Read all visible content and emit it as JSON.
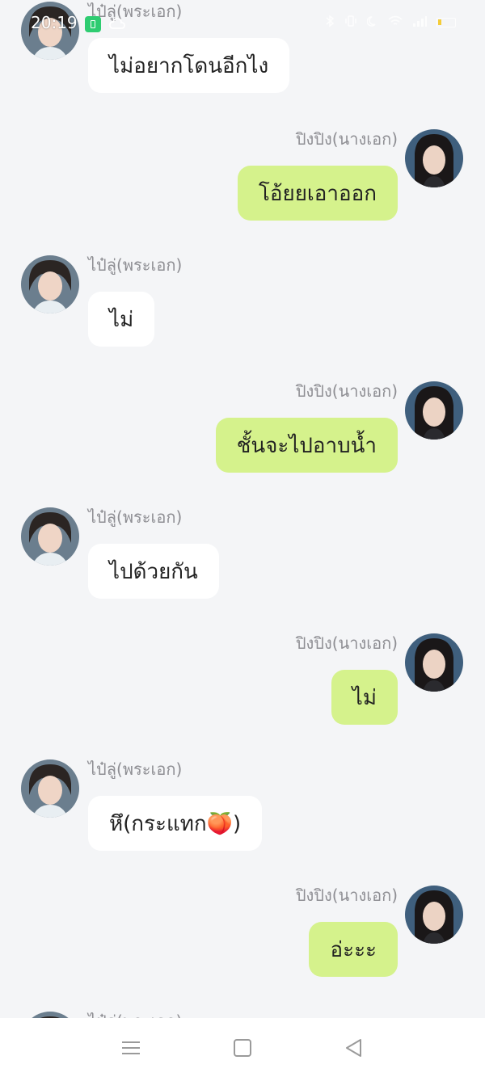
{
  "status_bar": {
    "time": "20:19"
  },
  "participants": {
    "lead_male": "ไป๋ลู่(พระเอก)",
    "lead_female": "ปิงปิง(นางเอก)"
  },
  "messages": [
    {
      "side": "left",
      "sender": "ไป๋ลู่(พระเอก)",
      "text": "ไม่อยากโดนอีกไง"
    },
    {
      "side": "right",
      "sender": "ปิงปิง(นางเอก)",
      "text": "โอ้ยยเอาออก"
    },
    {
      "side": "left",
      "sender": "ไป๋ลู่(พระเอก)",
      "text": "ไม่"
    },
    {
      "side": "right",
      "sender": "ปิงปิง(นางเอก)",
      "text": "ชั้นจะไปอาบน้ำ"
    },
    {
      "side": "left",
      "sender": "ไป๋ลู่(พระเอก)",
      "text": "ไปด้วยกัน"
    },
    {
      "side": "right",
      "sender": "ปิงปิง(นางเอก)",
      "text": "ไม่"
    },
    {
      "side": "left",
      "sender": "ไป๋ลู่(พระเอก)",
      "text": "หึ(กระแทก🍑)"
    },
    {
      "side": "right",
      "sender": "ปิงปิง(นางเอก)",
      "text": "อ่ะะะ"
    },
    {
      "side": "left",
      "sender": "ไป๋ลู่(พระเอก)",
      "text": ""
    }
  ],
  "colors": {
    "background": "#f4f5f7",
    "outgoing_bubble": "#d5f28c",
    "incoming_bubble": "#ffffff",
    "name_text": "#8e8e93"
  },
  "icons": {
    "status_left": [
      "notification-badge-icon",
      "cloud-icon"
    ],
    "status_right": [
      "bluetooth-icon",
      "vibrate-icon",
      "moon-icon",
      "wifi-icon",
      "signal-icon",
      "battery-icon"
    ],
    "nav": [
      "menu-icon",
      "home-icon",
      "back-icon"
    ]
  }
}
